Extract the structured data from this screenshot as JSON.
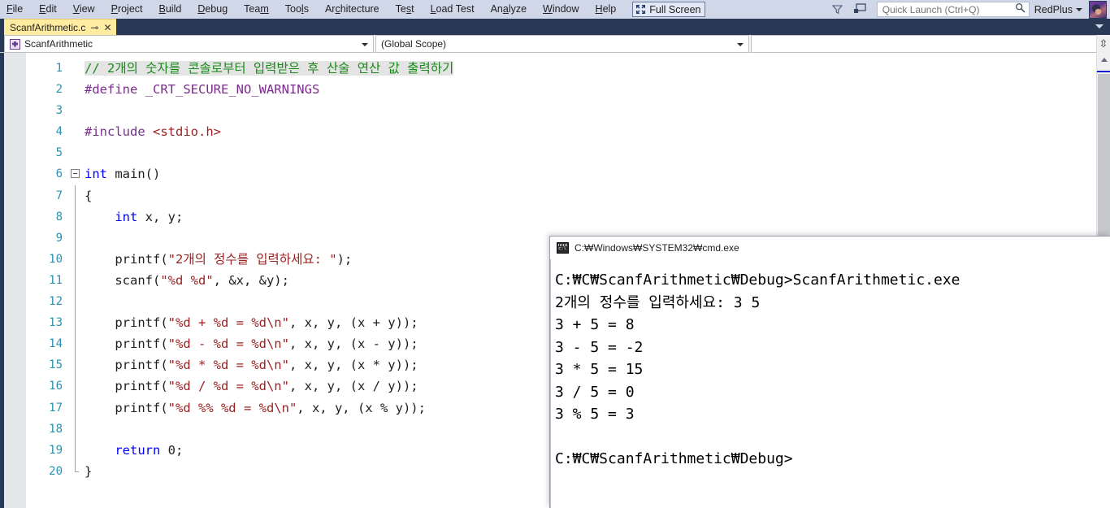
{
  "menu": {
    "items": [
      {
        "label": "File",
        "accel_index": 0
      },
      {
        "label": "Edit",
        "accel_index": 0
      },
      {
        "label": "View",
        "accel_index": 0
      },
      {
        "label": "Project",
        "accel_index": 0
      },
      {
        "label": "Build",
        "accel_index": 0
      },
      {
        "label": "Debug",
        "accel_index": 0
      },
      {
        "label": "Team",
        "accel_index": 3
      },
      {
        "label": "Tools",
        "accel_index": 3
      },
      {
        "label": "Architecture",
        "accel_index": 2
      },
      {
        "label": "Test",
        "accel_index": 2
      },
      {
        "label": "Load Test",
        "accel_index": 0
      },
      {
        "label": "Analyze",
        "accel_index": 2
      },
      {
        "label": "Window",
        "accel_index": 0
      },
      {
        "label": "Help",
        "accel_index": 0
      }
    ],
    "fullscreen_label": "Full Screen",
    "fullscreen_icon": "expand-arrows-icon",
    "filter_icon": "funnel-icon",
    "feedback_icon": "feedback-smiley-icon",
    "search_icon": "magnifier-icon"
  },
  "quick_launch": {
    "placeholder": "Quick Launch (Ctrl+Q)",
    "value": ""
  },
  "account": {
    "user_name": "RedPlus",
    "dropdown_icon": "chevron-down-icon",
    "avatar_icon": "user-avatar"
  },
  "tab": {
    "label": "ScanfArithmetic.c",
    "pin_glyph": "⊸",
    "close_glyph": "✕"
  },
  "navbar": {
    "project": "ScanfArithmetic",
    "project_icon": "project-node-icon",
    "scope": "(Global Scope)",
    "function": ""
  },
  "editor": {
    "line_numbers": [
      "1",
      "2",
      "3",
      "4",
      "5",
      "6",
      "7",
      "8",
      "9",
      "10",
      "11",
      "12",
      "13",
      "14",
      "15",
      "16",
      "17",
      "18",
      "19",
      "20"
    ],
    "lines": [
      {
        "n": 1,
        "highlight": true,
        "tokens": [
          {
            "t": "// 2개의 숫자를 콘솔로부터 입력받은 후 산술 연산 값 출력하기",
            "c": "c-comment"
          }
        ]
      },
      {
        "n": 2,
        "highlight": false,
        "tokens": [
          {
            "t": "#define",
            "c": "c-pp"
          },
          {
            "t": " ",
            "c": "c-plain"
          },
          {
            "t": "_CRT_SECURE_NO_WARNINGS",
            "c": "c-ppval"
          }
        ]
      },
      {
        "n": 3,
        "highlight": false,
        "tokens": []
      },
      {
        "n": 4,
        "highlight": false,
        "tokens": [
          {
            "t": "#include",
            "c": "c-pp"
          },
          {
            "t": " ",
            "c": "c-plain"
          },
          {
            "t": "<stdio.h>",
            "c": "c-str"
          }
        ]
      },
      {
        "n": 5,
        "highlight": false,
        "tokens": []
      },
      {
        "n": 6,
        "highlight": false,
        "tokens": [
          {
            "t": "int",
            "c": "c-kw"
          },
          {
            "t": " main()",
            "c": "c-plain"
          }
        ]
      },
      {
        "n": 7,
        "highlight": false,
        "tokens": [
          {
            "t": "{",
            "c": "c-brace"
          }
        ]
      },
      {
        "n": 8,
        "highlight": false,
        "tokens": [
          {
            "t": "    ",
            "c": "c-plain"
          },
          {
            "t": "int",
            "c": "c-kw"
          },
          {
            "t": " x, y;",
            "c": "c-plain"
          }
        ]
      },
      {
        "n": 9,
        "highlight": false,
        "tokens": []
      },
      {
        "n": 10,
        "highlight": false,
        "tokens": [
          {
            "t": "    printf(",
            "c": "c-plain"
          },
          {
            "t": "\"2개의 정수를 입력하세요: \"",
            "c": "c-str"
          },
          {
            "t": ");",
            "c": "c-plain"
          }
        ]
      },
      {
        "n": 11,
        "highlight": false,
        "tokens": [
          {
            "t": "    scanf(",
            "c": "c-plain"
          },
          {
            "t": "\"%d %d\"",
            "c": "c-str"
          },
          {
            "t": ", &x, &y);",
            "c": "c-plain"
          }
        ]
      },
      {
        "n": 12,
        "highlight": false,
        "tokens": []
      },
      {
        "n": 13,
        "highlight": false,
        "tokens": [
          {
            "t": "    printf(",
            "c": "c-plain"
          },
          {
            "t": "\"%d + %d = %d\\n\"",
            "c": "c-str"
          },
          {
            "t": ", x, y, (x + y));",
            "c": "c-plain"
          }
        ]
      },
      {
        "n": 14,
        "highlight": false,
        "tokens": [
          {
            "t": "    printf(",
            "c": "c-plain"
          },
          {
            "t": "\"%d - %d = %d\\n\"",
            "c": "c-str"
          },
          {
            "t": ", x, y, (x - y));",
            "c": "c-plain"
          }
        ]
      },
      {
        "n": 15,
        "highlight": false,
        "tokens": [
          {
            "t": "    printf(",
            "c": "c-plain"
          },
          {
            "t": "\"%d * %d = %d\\n\"",
            "c": "c-str"
          },
          {
            "t": ", x, y, (x * y));",
            "c": "c-plain"
          }
        ]
      },
      {
        "n": 16,
        "highlight": false,
        "tokens": [
          {
            "t": "    printf(",
            "c": "c-plain"
          },
          {
            "t": "\"%d / %d = %d\\n\"",
            "c": "c-str"
          },
          {
            "t": ", x, y, (x / y));",
            "c": "c-plain"
          }
        ]
      },
      {
        "n": 17,
        "highlight": false,
        "tokens": [
          {
            "t": "    printf(",
            "c": "c-plain"
          },
          {
            "t": "\"%d %% %d = %d\\n\"",
            "c": "c-str"
          },
          {
            "t": ", x, y, (x % y));",
            "c": "c-plain"
          }
        ]
      },
      {
        "n": 18,
        "highlight": false,
        "tokens": []
      },
      {
        "n": 19,
        "highlight": false,
        "tokens": [
          {
            "t": "    ",
            "c": "c-plain"
          },
          {
            "t": "return",
            "c": "c-kw"
          },
          {
            "t": " ",
            "c": "c-plain"
          },
          {
            "t": "0",
            "c": "c-plain"
          },
          {
            "t": ";",
            "c": "c-plain"
          }
        ]
      },
      {
        "n": 20,
        "highlight": false,
        "tokens": [
          {
            "t": "}",
            "c": "c-brace"
          }
        ]
      }
    ],
    "fold_marker_line": 6,
    "scrollbar_marker_color": "#1414c8"
  },
  "console": {
    "title": "C:₩Windows₩SYSTEM32₩cmd.exe",
    "icon": "cmd-window-icon",
    "lines": [
      "C:₩C₩ScanfArithmetic₩Debug>ScanfArithmetic.exe",
      "2개의 정수를 입력하세요: 3 5",
      "3 + 5 = 8",
      "3 - 5 = -2",
      "3 * 5 = 15",
      "3 / 5 = 0",
      "3 % 5 = 3",
      "",
      "C:₩C₩ScanfArithmetic₩Debug>"
    ]
  },
  "colors": {
    "menubar_bg": "#d0d7e8",
    "tabstrip_bg": "#293955",
    "active_tab_bg": "#ffeca0",
    "comment_green": "#1a8a1a",
    "preprocessor_purple": "#7b2d8e",
    "string_red": "#9b2222",
    "keyword_blue": "#0000ff",
    "linenumber_teal": "#2b91af"
  }
}
